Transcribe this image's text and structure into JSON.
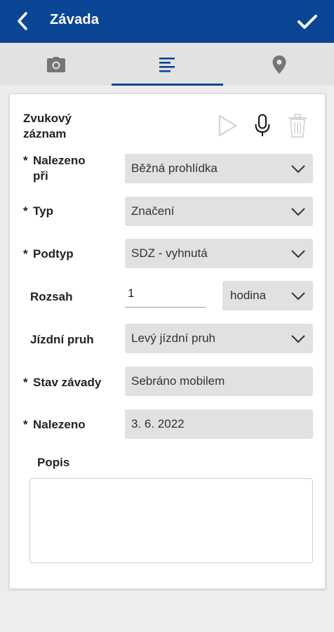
{
  "appbar": {
    "title": "Závada",
    "back_icon": "chevron-left-icon",
    "confirm_icon": "checkmark-icon"
  },
  "tabs": [
    {
      "name": "photo",
      "icon": "camera-icon"
    },
    {
      "name": "details",
      "icon": "text-lines-icon",
      "active": true
    },
    {
      "name": "location",
      "icon": "map-pin-icon"
    }
  ],
  "audio": {
    "label_line1": "Zvukový",
    "label_line2": "záznam",
    "play_icon": "play-icon",
    "mic_icon": "microphone-icon",
    "delete_icon": "trash-icon"
  },
  "form": {
    "nalezeno_pri": {
      "required": "*",
      "label_line1": "Nalezeno",
      "label_line2": "při",
      "value": "Běžná prohlídka"
    },
    "typ": {
      "required": "*",
      "label": "Typ",
      "value": "Značení"
    },
    "podtyp": {
      "required": "*",
      "label": "Podtyp",
      "value": "SDZ - vyhnutá"
    },
    "rozsah": {
      "label": "Rozsah",
      "value": "1",
      "unit": "hodina"
    },
    "jizdni_pruh": {
      "label": "Jízdní pruh",
      "value": "Levý jízdní pruh"
    },
    "stav_zavady": {
      "required": "*",
      "label": "Stav závady",
      "value": "Sebráno mobilem"
    },
    "nalezeno": {
      "required": "*",
      "label": "Nalezeno",
      "value": "3. 6. 2022"
    },
    "popis": {
      "label": "Popis",
      "value": ""
    }
  },
  "colors": {
    "primary": "#0b4596",
    "field_bg": "#e1e1e1",
    "tab_bg": "#e2e2e2",
    "disabled_icon": "#d5d5d5"
  }
}
